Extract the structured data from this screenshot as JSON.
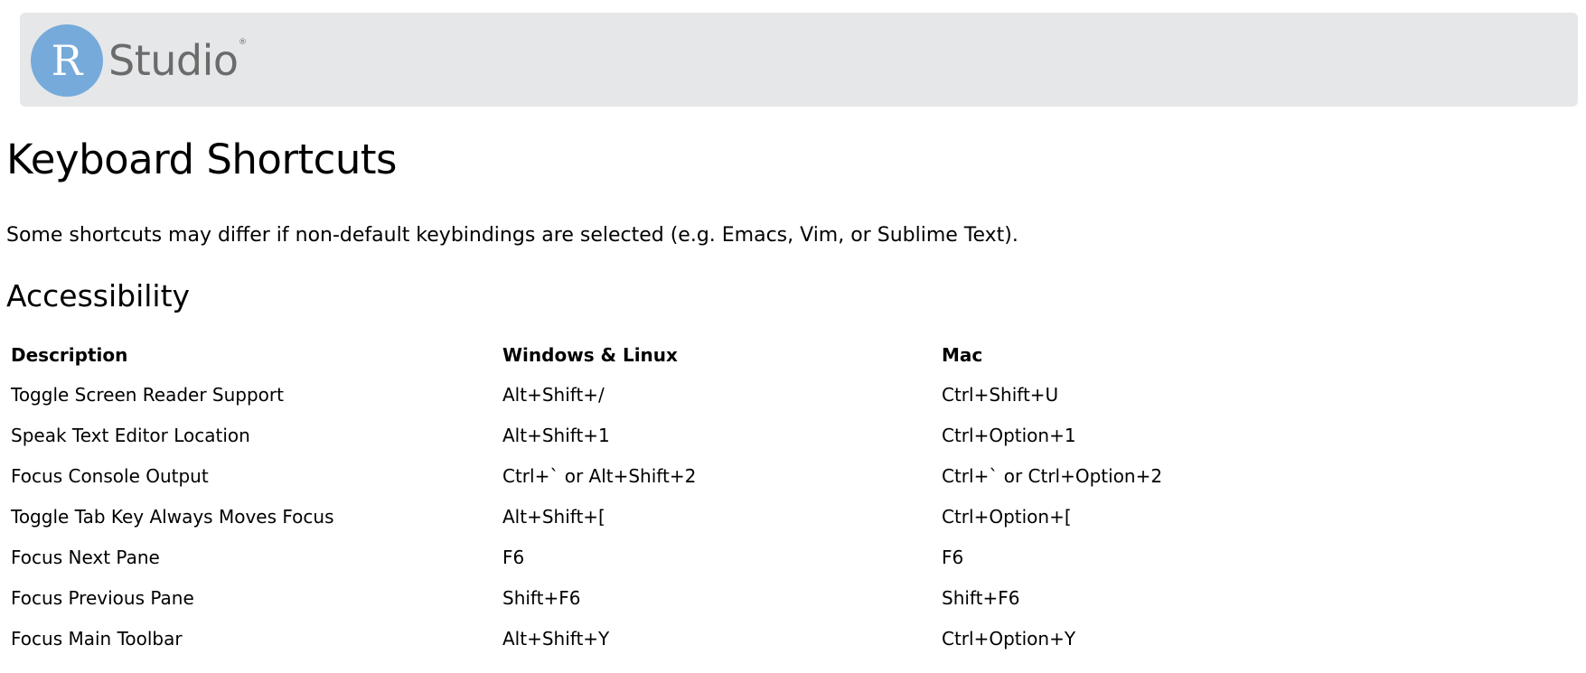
{
  "logo": {
    "letter": "R",
    "word": "Studio",
    "mark": "®"
  },
  "page": {
    "title": "Keyboard Shortcuts",
    "intro": "Some shortcuts may differ if non-default keybindings are selected (e.g. Emacs, Vim, or Sublime Text)."
  },
  "section": {
    "title": "Accessibility",
    "headers": {
      "description": "Description",
      "windows_linux": "Windows & Linux",
      "mac": "Mac"
    },
    "rows": [
      {
        "description": "Toggle Screen Reader Support",
        "windows_linux": "Alt+Shift+/",
        "mac": "Ctrl+Shift+U"
      },
      {
        "description": "Speak Text Editor Location",
        "windows_linux": "Alt+Shift+1",
        "mac": "Ctrl+Option+1"
      },
      {
        "description": "Focus Console Output",
        "windows_linux": "Ctrl+` or Alt+Shift+2",
        "mac": "Ctrl+` or Ctrl+Option+2"
      },
      {
        "description": "Toggle Tab Key Always Moves Focus",
        "windows_linux": "Alt+Shift+[",
        "mac": "Ctrl+Option+["
      },
      {
        "description": "Focus Next Pane",
        "windows_linux": "F6",
        "mac": "F6"
      },
      {
        "description": "Focus Previous Pane",
        "windows_linux": "Shift+F6",
        "mac": "Shift+F6"
      },
      {
        "description": "Focus Main Toolbar",
        "windows_linux": "Alt+Shift+Y",
        "mac": "Ctrl+Option+Y"
      }
    ]
  },
  "colors": {
    "header_bg": "#e6e7e9",
    "logo_circle": "#75aadb",
    "logo_text": "#6b6b6b"
  }
}
